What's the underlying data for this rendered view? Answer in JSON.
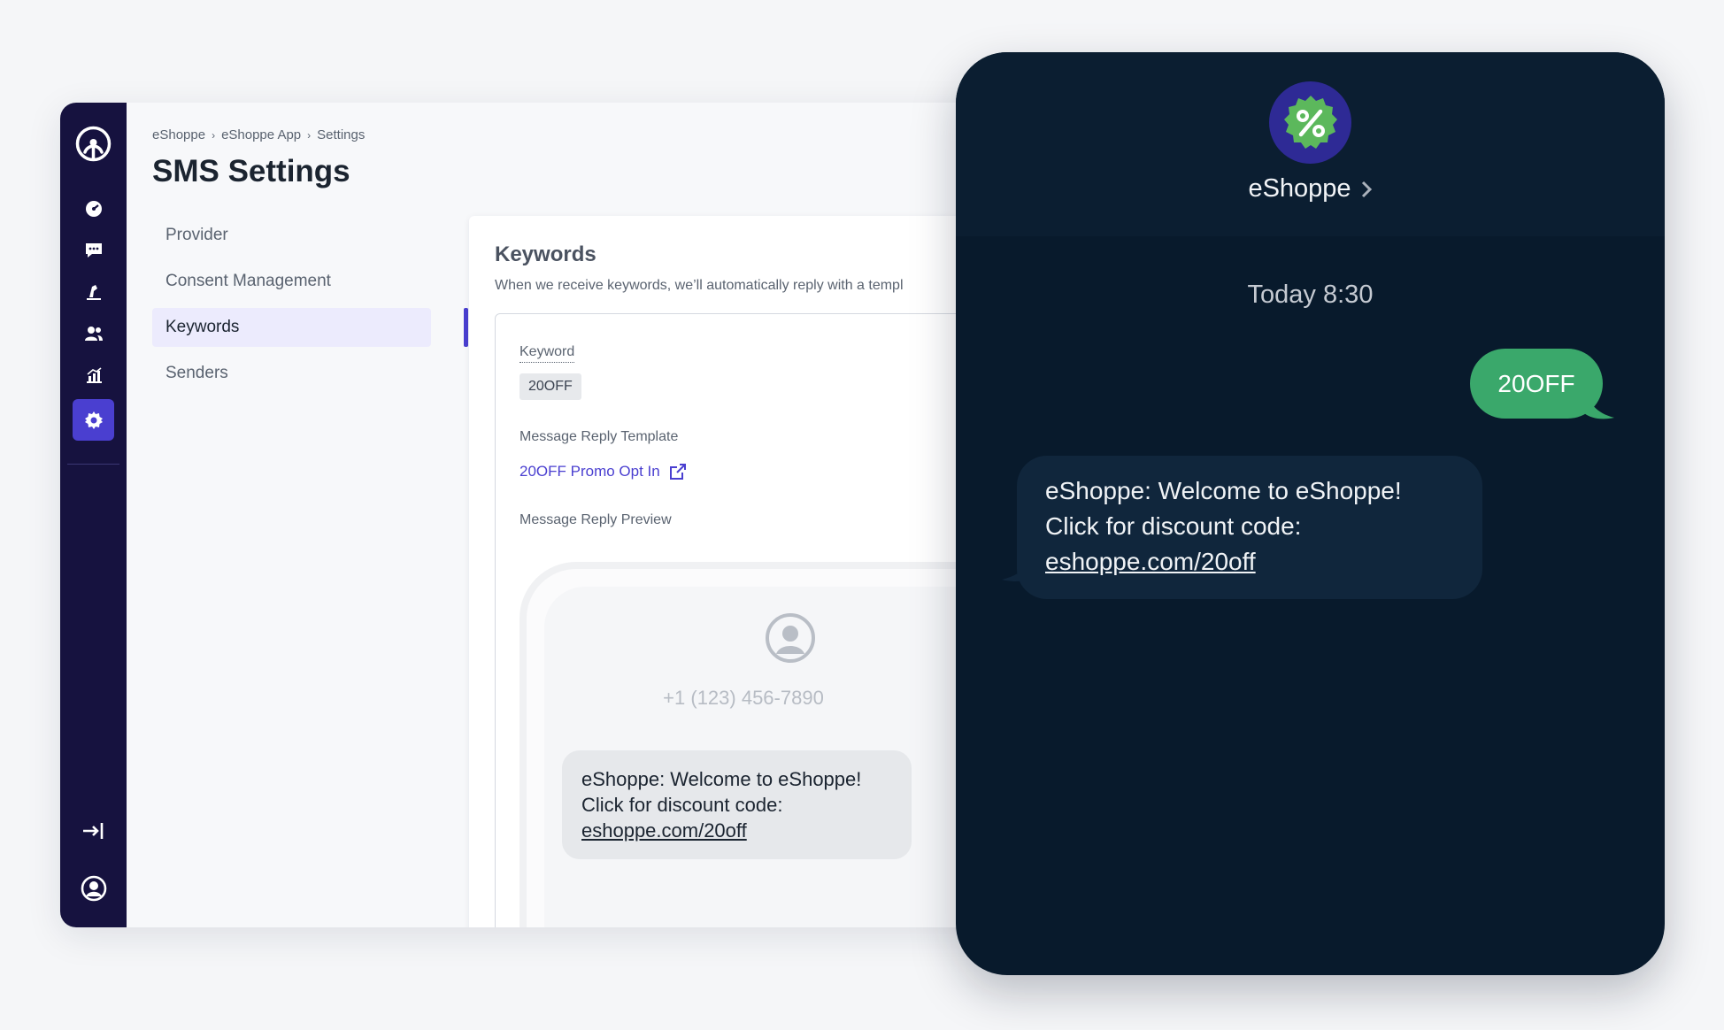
{
  "app": {
    "breadcrumb": [
      "eShoppe",
      "eShoppe App",
      "Settings"
    ],
    "breadcrumb_separator": "›",
    "page_title": "SMS Settings",
    "rail": {
      "icons": [
        "dashboard-icon",
        "chat-icon",
        "campaign-icon",
        "people-icon",
        "analytics-icon",
        "settings-icon"
      ],
      "active": "settings-icon",
      "bottom_icons": [
        "collapse-icon",
        "account-icon"
      ]
    },
    "subnav": {
      "items": [
        "Provider",
        "Consent Management",
        "Keywords",
        "Senders"
      ],
      "active": "Keywords"
    },
    "panel": {
      "title": "Keywords",
      "description": "When we receive keywords, we’ll automatically reply with a templ",
      "keyword_label": "Keyword",
      "keyword_value": "20OFF",
      "template_label": "Message Reply Template",
      "template_link": "20OFF Promo Opt In",
      "preview_label": "Message Reply Preview",
      "preview": {
        "phone_number": "+1 (123) 456-7890",
        "message_line1": "eShoppe: Welcome to eShoppe!",
        "message_line2": "Click for discount code:",
        "message_link": "eshoppe.com/20off"
      }
    }
  },
  "phone": {
    "brand_name": "eShoppe",
    "timestamp_day": "Today",
    "timestamp_time": "8:30",
    "sent_message": "20OFF",
    "received_line1": "eShoppe: Welcome to eShoppe!",
    "received_line2": "Click for discount code:",
    "received_link": "eshoppe.com/20off"
  },
  "colors": {
    "rail_bg": "#16123f",
    "accent": "#4a3fd0",
    "phone_bg": "#081a2c",
    "sent_bubble": "#3aa86b",
    "received_bubble": "#10263c"
  }
}
